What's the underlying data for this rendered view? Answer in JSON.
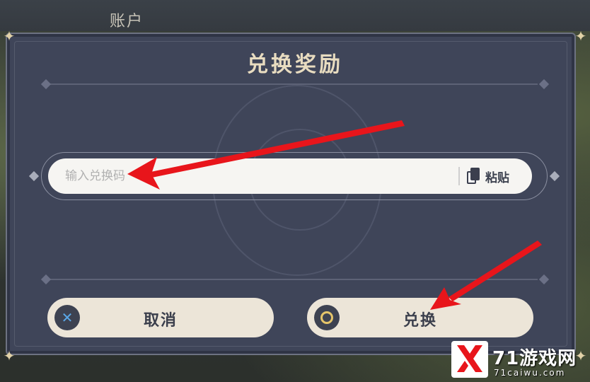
{
  "header": {
    "account_label": "账户"
  },
  "dialog": {
    "title": "兑换奖励",
    "input": {
      "placeholder": "输入兑换码",
      "value": ""
    },
    "paste_label": "粘贴",
    "cancel_label": "取消",
    "confirm_label": "兑换"
  },
  "watermark": {
    "brand": "71游戏网",
    "site": "71caiwu.com"
  },
  "colors": {
    "dialog_bg": "#3f4559",
    "button_bg": "#ece5d8",
    "title_gold": "#e8dcc0",
    "arrow_red": "#e8151b",
    "cancel_icon_blue": "#5aa8e8",
    "confirm_icon_gold": "#e5c56a"
  },
  "icons": {
    "cancel": "close-x-icon",
    "confirm": "circle-icon",
    "paste": "clipboard-copy-icon"
  }
}
